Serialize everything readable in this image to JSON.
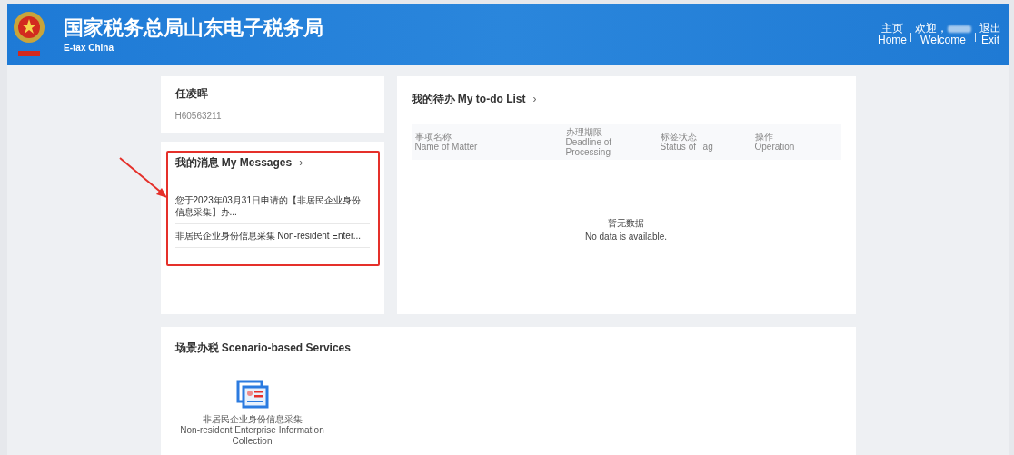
{
  "header": {
    "title": "国家税务总局山东电子税务局",
    "subtitle": "E-tax China",
    "nav": [
      {
        "kind": "link",
        "zh": "主页",
        "en": "Home"
      },
      {
        "kind": "welcome",
        "zh": "欢迎，",
        "en": "Welcome"
      },
      {
        "kind": "link",
        "zh": "退出",
        "en": "Exit"
      }
    ]
  },
  "profile": {
    "name": "任凌晖",
    "id": "H60563211"
  },
  "messages": {
    "title": "我的消息 My Messages",
    "chevron": "›",
    "items": [
      "您于2023年03月31日申请的【非居民企业身份信息采集】办...",
      "非居民企业身份信息采集 Non-resident Enter..."
    ]
  },
  "todo": {
    "title": "我的待办 My to-do List",
    "chevron": "›",
    "columns": [
      {
        "zh": "事项名称",
        "en": "Name of Matter"
      },
      {
        "zh": "办理期限",
        "en": "Deadline of Processing"
      },
      {
        "zh": "标签状态",
        "en": "Status of Tag"
      },
      {
        "zh": "操作",
        "en": "Operation"
      }
    ],
    "empty": {
      "zh": "暂无数据",
      "en": "No data is available."
    }
  },
  "services": {
    "title": "场景办税 Scenario-based Services",
    "items": [
      {
        "zh": "非居民企业身份信息采集",
        "en": "Non-resident Enterprise Information Collection"
      }
    ]
  }
}
